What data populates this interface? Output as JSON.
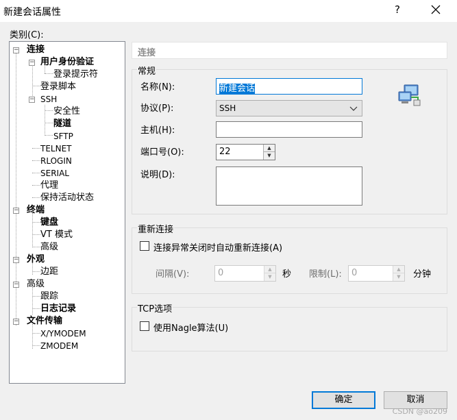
{
  "window": {
    "title": "新建会话属性",
    "help": "?"
  },
  "category_label": "类别(C):",
  "tree": {
    "connection": "连接",
    "auth": "用户身份验证",
    "login_prompt": "登录提示符",
    "login_script": "登录脚本",
    "ssh": "SSH",
    "security": "安全性",
    "tunnel": "隧道",
    "sftp": "SFTP",
    "telnet": "TELNET",
    "rlogin": "RLOGIN",
    "serial": "SERIAL",
    "proxy": "代理",
    "keepalive": "保持活动状态",
    "terminal": "终端",
    "keyboard": "键盘",
    "vt_mode": "VT 模式",
    "advanced": "高级",
    "appearance": "外观",
    "margin": "边距",
    "advanced2": "高级",
    "trace": "跟踪",
    "logging": "日志记录",
    "file_transfer": "文件传输",
    "xymodem": "X/YMODEM",
    "zmodem": "ZMODEM"
  },
  "header": {
    "title": "连接"
  },
  "general": {
    "title": "常规",
    "name_label": "名称(N):",
    "name_value": "新建会话",
    "protocol_label": "协议(P):",
    "protocol_value": "SSH",
    "host_label": "主机(H):",
    "host_value": "",
    "port_label": "端口号(O):",
    "port_value": "22",
    "desc_label": "说明(D):",
    "desc_value": ""
  },
  "reconnect": {
    "title": "重新连接",
    "checkbox_label": "连接异常关闭时自动重新连接(A)",
    "interval_label": "间隔(V):",
    "interval_value": "0",
    "seconds": "秒",
    "limit_label": "限制(L):",
    "limit_value": "0",
    "minutes": "分钟"
  },
  "tcp": {
    "title": "TCP选项",
    "nagle_label": "使用Nagle算法(U)"
  },
  "buttons": {
    "ok": "确定",
    "cancel": "取消"
  },
  "watermark": "CSDN @ao209",
  "colors": {
    "accent": "#0078d7",
    "window_bg": "#f0f0f0"
  }
}
